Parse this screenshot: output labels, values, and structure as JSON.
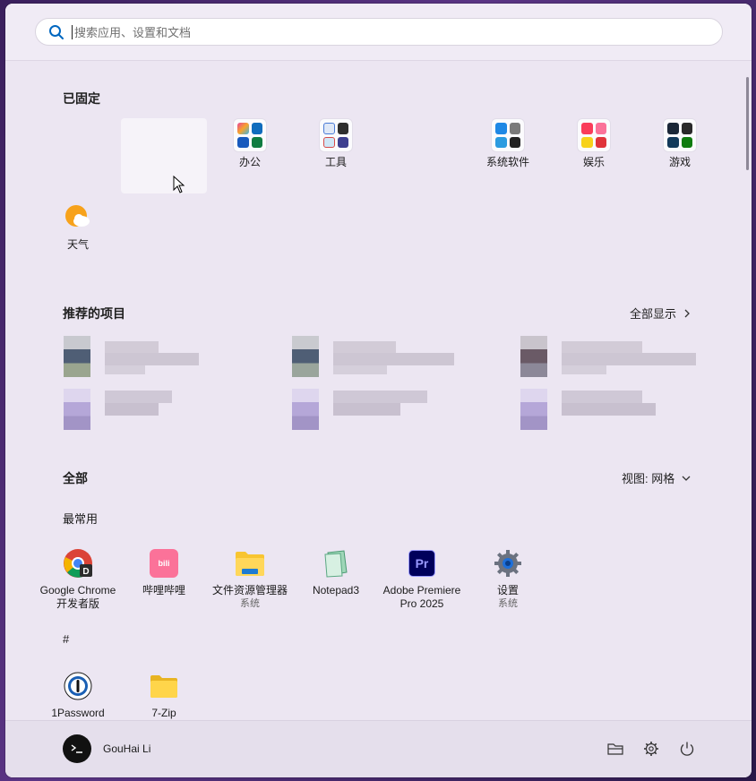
{
  "search": {
    "placeholder": "搜索应用、设置和文档"
  },
  "pinned": {
    "title": "已固定",
    "items": [
      {
        "label": "办公",
        "icon": "office-folder-icon"
      },
      {
        "label": "工具",
        "icon": "tools-folder-icon"
      },
      {
        "label": "系统软件",
        "icon": "system-folder-icon"
      },
      {
        "label": "娱乐",
        "icon": "entertainment-folder-icon"
      },
      {
        "label": "游戏",
        "icon": "games-folder-icon"
      },
      {
        "label": "天气",
        "icon": "weather-icon"
      }
    ]
  },
  "recommended": {
    "title": "推荐的项目",
    "show_all": "全部显示"
  },
  "all": {
    "title": "全部",
    "view": "视图: 网格",
    "most_used_title": "最常用",
    "most_used": [
      {
        "label": "Google Chrome 开发者版",
        "label1": "Google Chrome",
        "label2": "开发者版",
        "sub": "",
        "icon": "chrome-dev-icon"
      },
      {
        "label1": "哔哩哔哩",
        "label2": "",
        "sub": "",
        "icon": "bilibili-icon"
      },
      {
        "label1": "文件资源管理器",
        "label2": "",
        "sub": "系统",
        "icon": "file-explorer-icon"
      },
      {
        "label1": "Notepad3",
        "label2": "",
        "sub": "",
        "icon": "notepad3-icon"
      },
      {
        "label1": "Adobe Premiere",
        "label2": "Pro 2025",
        "sub": "",
        "icon": "premiere-icon"
      },
      {
        "label1": "设置",
        "label2": "",
        "sub": "系统",
        "icon": "settings-icon"
      }
    ],
    "hash_title": "#",
    "hash_items": [
      {
        "label1": "1Password",
        "icon": "1password-icon"
      },
      {
        "label1": "7-Zip",
        "icon": "7zip-folder-icon"
      }
    ]
  },
  "user": {
    "name": "GouHai Li"
  },
  "colors": {
    "accent": "#0067c0",
    "panel": "#ece6f2"
  }
}
